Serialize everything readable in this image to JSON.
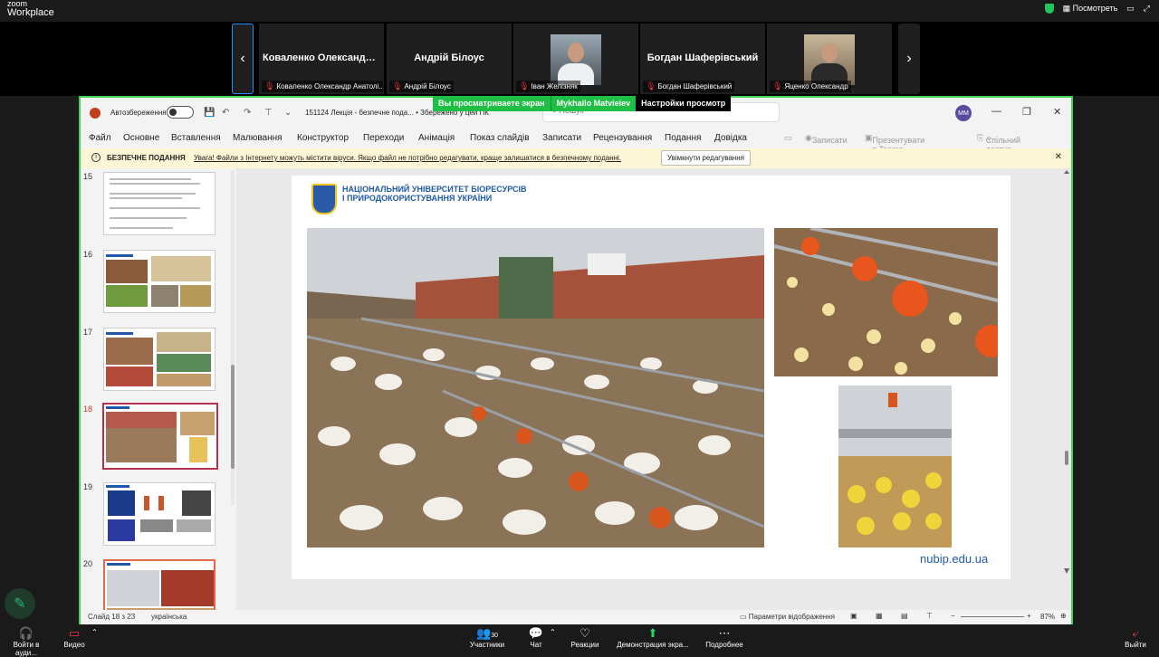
{
  "zoom": {
    "brand_top": "zoom",
    "brand": "Workplace",
    "view_label": "Посмотреть"
  },
  "participants": [
    {
      "name": "Коваленко Олександр ...",
      "label": "Коваленко Олександр Анатолі..."
    },
    {
      "name": "Андрій Білоус",
      "label": "Андрій Білоус"
    },
    {
      "name": "",
      "label": "Іван Желізняк"
    },
    {
      "name": "Богдан Шаферівський",
      "label": "Богдан Шаферівський"
    },
    {
      "name": "",
      "label": "Яценко Олександр"
    }
  ],
  "share_bar": {
    "viewing": "Вы просматриваете экран",
    "presenter": "Mykhailo Matvieiev",
    "settings": "Настройки просмотр"
  },
  "ppt": {
    "autosave": "Автозбереження",
    "filename": "151124 Лекція - безпечне пода... • Збережено у цей ПК",
    "search_placeholder": "Пошук",
    "avatar": "MM",
    "menu": [
      "Файл",
      "Основне",
      "Вставлення",
      "Малювання",
      "Конструктор",
      "Переходи",
      "Анімація",
      "Показ слайдів",
      "Записати",
      "Рецензування",
      "Подання",
      "Довідка"
    ],
    "record": "Записати",
    "present_teams": "Презентувати в Teams",
    "share": "Спільний доступ",
    "info_title": "БЕЗПЕЧНЕ ПОДАННЯ",
    "info_msg": "Увага! Файли з Інтернету можуть містити віруси. Якщо файл не потрібно редагувати, краще залишатися в безпечному поданні.",
    "info_button": "Увімкнути редагування",
    "slide_numbers": [
      "15",
      "16",
      "17",
      "18",
      "19",
      "20"
    ],
    "selected_slide": "18",
    "university_line1": "НАЦІОНАЛЬНИЙ УНІВЕРСИТЕТ БІОРЕСУРСІВ",
    "university_line2": "І ПРИРОДОКОРИСТУВАННЯ УКРАЇНИ",
    "site": "nubip.edu.ua",
    "status_slide": "Слайд 18 з 23",
    "status_lang": "українська",
    "view_params": "Параметри відображення",
    "zoom_pct": "87%"
  },
  "toolbar": {
    "audio": "Войти в ауди...",
    "video": "Видео",
    "participants": "Участники",
    "participants_count": "30",
    "chat": "Чат",
    "reactions": "Реакции",
    "share": "Демонстрация экра...",
    "more": "Подробнее",
    "leave": "Выйти"
  }
}
